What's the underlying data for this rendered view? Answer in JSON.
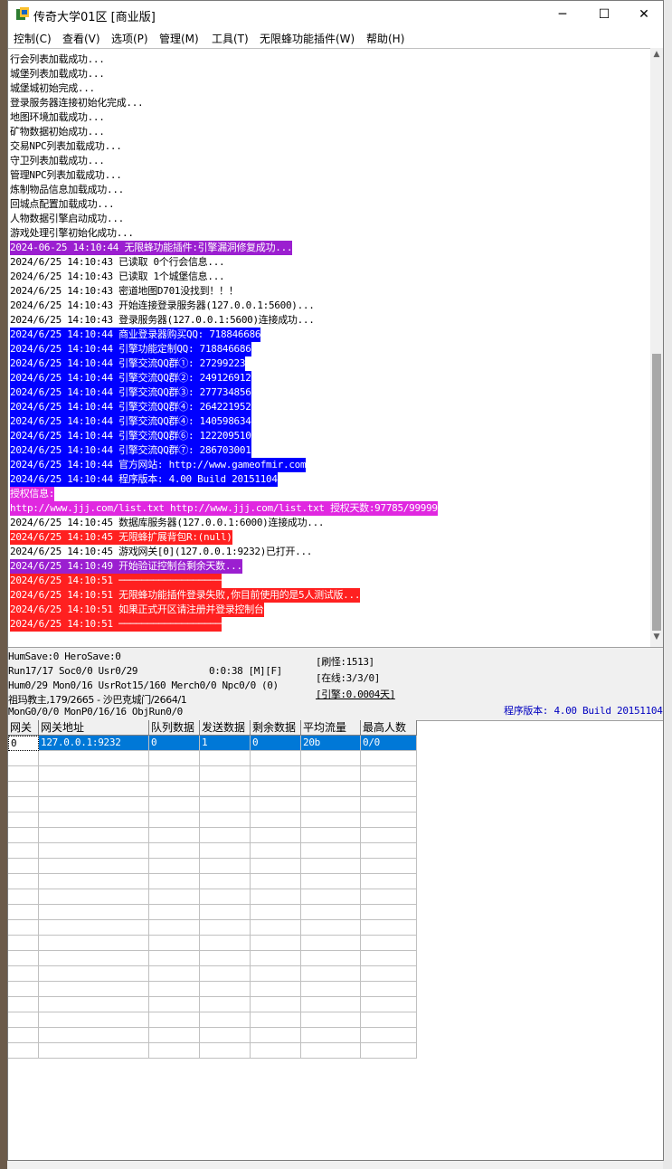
{
  "window": {
    "title": "传奇大学01区 [商业版]",
    "controls": {
      "minimize": "─",
      "maximize": "☐",
      "close": "✕"
    }
  },
  "menu": [
    "控制(C)",
    "查看(V)",
    "选项(P)",
    "管理(M)",
    "工具(T)",
    "无限蜂功能插件(W)",
    "帮助(H)"
  ],
  "log": [
    {
      "text": "行会列表加载成功...",
      "style": ""
    },
    {
      "text": "城堡列表加载成功...",
      "style": ""
    },
    {
      "text": "城堡城初始完成...",
      "style": ""
    },
    {
      "text": "登录服务器连接初始化完成...",
      "style": ""
    },
    {
      "text": "地图环境加载成功...",
      "style": ""
    },
    {
      "text": "矿物数据初始成功...",
      "style": ""
    },
    {
      "text": "交易NPC列表加载成功...",
      "style": ""
    },
    {
      "text": "守卫列表加载成功...",
      "style": ""
    },
    {
      "text": "管理NPC列表加载成功...",
      "style": ""
    },
    {
      "text": "炼制物品信息加载成功...",
      "style": ""
    },
    {
      "text": "回城点配置加载成功...",
      "style": ""
    },
    {
      "text": "人物数据引擎启动成功...",
      "style": ""
    },
    {
      "text": "游戏处理引擎初始化成功...",
      "style": ""
    },
    {
      "text": "2024-06-25 14:10:44 无限蜂功能插件:引擎漏洞修复成功...",
      "style": "purple"
    },
    {
      "text": "2024/6/25 14:10:43 已读取 0个行会信息...",
      "style": ""
    },
    {
      "text": "2024/6/25 14:10:43 已读取 1个城堡信息...",
      "style": ""
    },
    {
      "text": "2024/6/25 14:10:43 密道地图D701没找到！！！",
      "style": ""
    },
    {
      "text": "2024/6/25 14:10:43 开始连接登录服务器(127.0.0.1:5600)...",
      "style": ""
    },
    {
      "text": "2024/6/25 14:10:43 登录服务器(127.0.0.1:5600)连接成功...",
      "style": ""
    },
    {
      "text": "2024/6/25 14:10:44 商业登录器购买QQ: 718846686",
      "style": "blue"
    },
    {
      "text": "2024/6/25 14:10:44 引擎功能定制QQ: 718846686",
      "style": "blue"
    },
    {
      "text": "2024/6/25 14:10:44 引擎交流QQ群①: 27299223",
      "style": "blue"
    },
    {
      "text": "2024/6/25 14:10:44 引擎交流QQ群②: 249126912",
      "style": "blue"
    },
    {
      "text": "2024/6/25 14:10:44 引擎交流QQ群③: 277734856",
      "style": "blue"
    },
    {
      "text": "2024/6/25 14:10:44 引擎交流QQ群④: 264221952",
      "style": "blue"
    },
    {
      "text": "2024/6/25 14:10:44 引擎交流QQ群④: 140598634",
      "style": "blue"
    },
    {
      "text": "2024/6/25 14:10:44 引擎交流QQ群⑥: 122209510",
      "style": "blue"
    },
    {
      "text": "2024/6/25 14:10:44 引擎交流QQ群⑦: 286703001",
      "style": "blue"
    },
    {
      "text": "2024/6/25 14:10:44 官方网站: http://www.gameofmir.com",
      "style": "blue"
    },
    {
      "text": "2024/6/25 14:10:44 程序版本: 4.00 Build 20151104",
      "style": "blue"
    },
    {
      "text": "授权信息:",
      "style": "magenta"
    },
    {
      "text": "http://www.jjj.com/list.txt http://www.jjj.com/list.txt 授权天数:97785/99999",
      "style": "magenta"
    },
    {
      "text": "2024/6/25 14:10:45 数据库服务器(127.0.0.1:6000)连接成功...",
      "style": ""
    },
    {
      "text": "2024/6/25 14:10:45 无限蜂扩展背包R:(null)",
      "style": "red"
    },
    {
      "text": "2024/6/25 14:10:45 游戏网关[0](127.0.0.1:9232)已打开...",
      "style": ""
    },
    {
      "text": "2024/6/25 14:10:49 开始验证控制台剩余天数...",
      "style": "purple"
    },
    {
      "text": "2024/6/25 14:10:51 ──────────────────",
      "style": "red"
    },
    {
      "text": "2024/6/25 14:10:51 无限蜂功能插件登录失败,你目前使用的是5人测试版...",
      "style": "red"
    },
    {
      "text": "2024/6/25 14:10:51 如果正式开区请注册并登录控制台",
      "style": "red"
    },
    {
      "text": "2024/6/25 14:10:51 ──────────────────",
      "style": "red"
    }
  ],
  "status": {
    "line1": "HumSave:0 HeroSave:0",
    "line2": "Run17/17 Soc0/0 Usr0/29",
    "time": "0:0:38 [M][F]",
    "line3": "Hum0/29 Mon0/16 UsrRot15/160 Merch0/0 Npc0/0 (0)",
    "line4": "祖玛教主,179/2665 - 沙巴克城门/2664/1",
    "line5": "MonG0/0/0 MonP0/16/16 ObjRun0/0",
    "refresh": "[刷怪:1513]",
    "online": "[在线:3/3/0]",
    "engine": "[引擎:0.0004天]",
    "version": "程序版本: 4.00 Build 20151104"
  },
  "grid": {
    "headers": [
      "网关",
      "网关地址",
      "队列数据",
      "发送数据",
      "剩余数据",
      "平均流量",
      "最高人数"
    ],
    "rows": [
      [
        "0",
        "127.0.0.1:9232",
        "0",
        "1",
        "0",
        "20b",
        "0/0"
      ]
    ],
    "empty_rows": 20
  },
  "colors": {
    "purple": "#9b1fd0",
    "blue": "#0000ff",
    "magenta": "#e028e0",
    "red": "#ff2020",
    "selected": "#0078d7",
    "version_text": "#0000c0"
  }
}
